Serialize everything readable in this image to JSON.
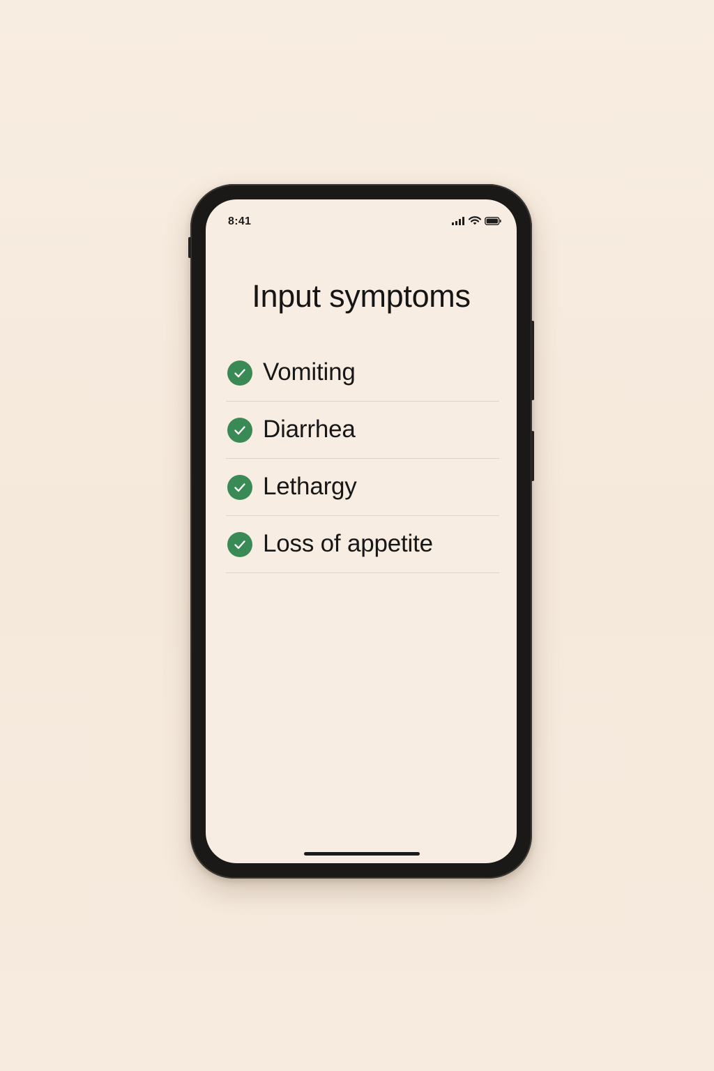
{
  "status_bar": {
    "time": "8:41",
    "icons": [
      "cellular-signal-icon",
      "wifi-icon",
      "battery-icon"
    ]
  },
  "screen": {
    "title": "Input symptoms",
    "symptoms": [
      {
        "label": "Vomiting",
        "checked": true
      },
      {
        "label": "Diarrhea",
        "checked": true
      },
      {
        "label": "Lethargy",
        "checked": true
      },
      {
        "label": "Loss of appetite",
        "checked": true
      }
    ]
  },
  "colors": {
    "background": "#f7ede2",
    "check_green": "#3a8a55",
    "text": "#171717",
    "divider": "#ddd4c9",
    "phone_frame": "#1a1917"
  }
}
